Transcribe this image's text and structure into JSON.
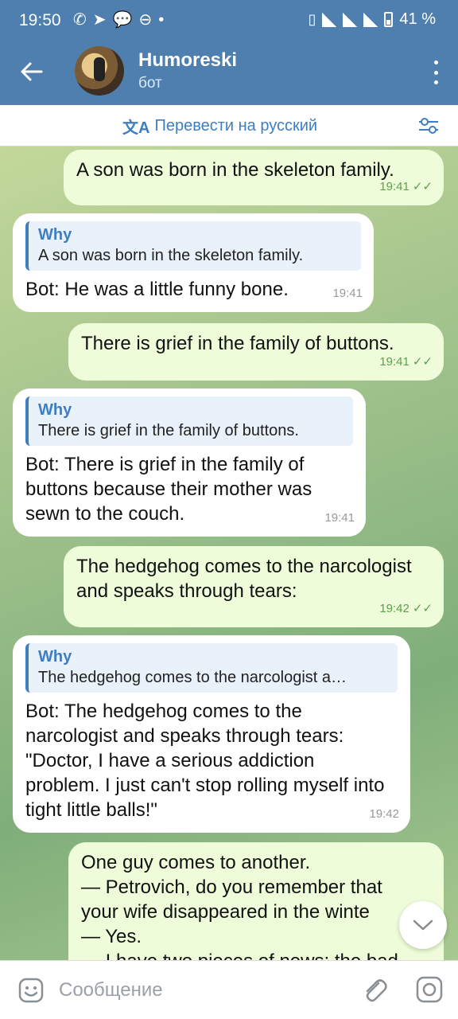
{
  "status_bar": {
    "time": "19:50",
    "battery": "41 %",
    "notification_icons": [
      "whatsapp-icon",
      "telegram-icon",
      "chat-icon",
      "dnd-icon"
    ]
  },
  "header": {
    "title": "Humoreski",
    "subtitle": "бот"
  },
  "translate": {
    "label": "Перевести на русский"
  },
  "messages": [
    {
      "type": "out",
      "text": "A son was born in the skeleton family.",
      "time": "19:41"
    },
    {
      "type": "in",
      "reply_name": "Why",
      "reply_text": "A son was born in the skeleton family.",
      "text": "Bot: He was a little funny bone.",
      "time": "19:41"
    },
    {
      "type": "out",
      "text": "There is grief in the family of buttons.",
      "time": "19:41"
    },
    {
      "type": "in",
      "reply_name": "Why",
      "reply_text": "There is grief in the family of buttons.",
      "text": "Bot: There is grief in the family of buttons because their mother was sewn to the couch.",
      "time": "19:41"
    },
    {
      "type": "out",
      "text": "The hedgehog comes to the narcologist and speaks through tears:",
      "time": "19:42"
    },
    {
      "type": "in",
      "reply_name": "Why",
      "reply_text": "The hedgehog comes to the narcologist a…",
      "text": "Bot: The hedgehog comes to the narcologist and speaks through tears: \"Doctor, I have a serious addiction problem. I just can't stop rolling myself into tight little balls!\"",
      "time": "19:42"
    },
    {
      "type": "out",
      "line1": "One guy comes to another.",
      "line2": "— Petrovich, do you remember that",
      "line3": "your wife disappeared in the winte",
      "line4": "— Yes.",
      "line5": "— I have two pieces of news: the bad"
    }
  ],
  "input": {
    "placeholder": "Сообщение"
  },
  "colors": {
    "header": "#4f7fae",
    "out_bubble": "#eefcd9",
    "in_bubble": "#ffffff",
    "accent": "#3d7ec2",
    "tick": "#5aa24c"
  }
}
